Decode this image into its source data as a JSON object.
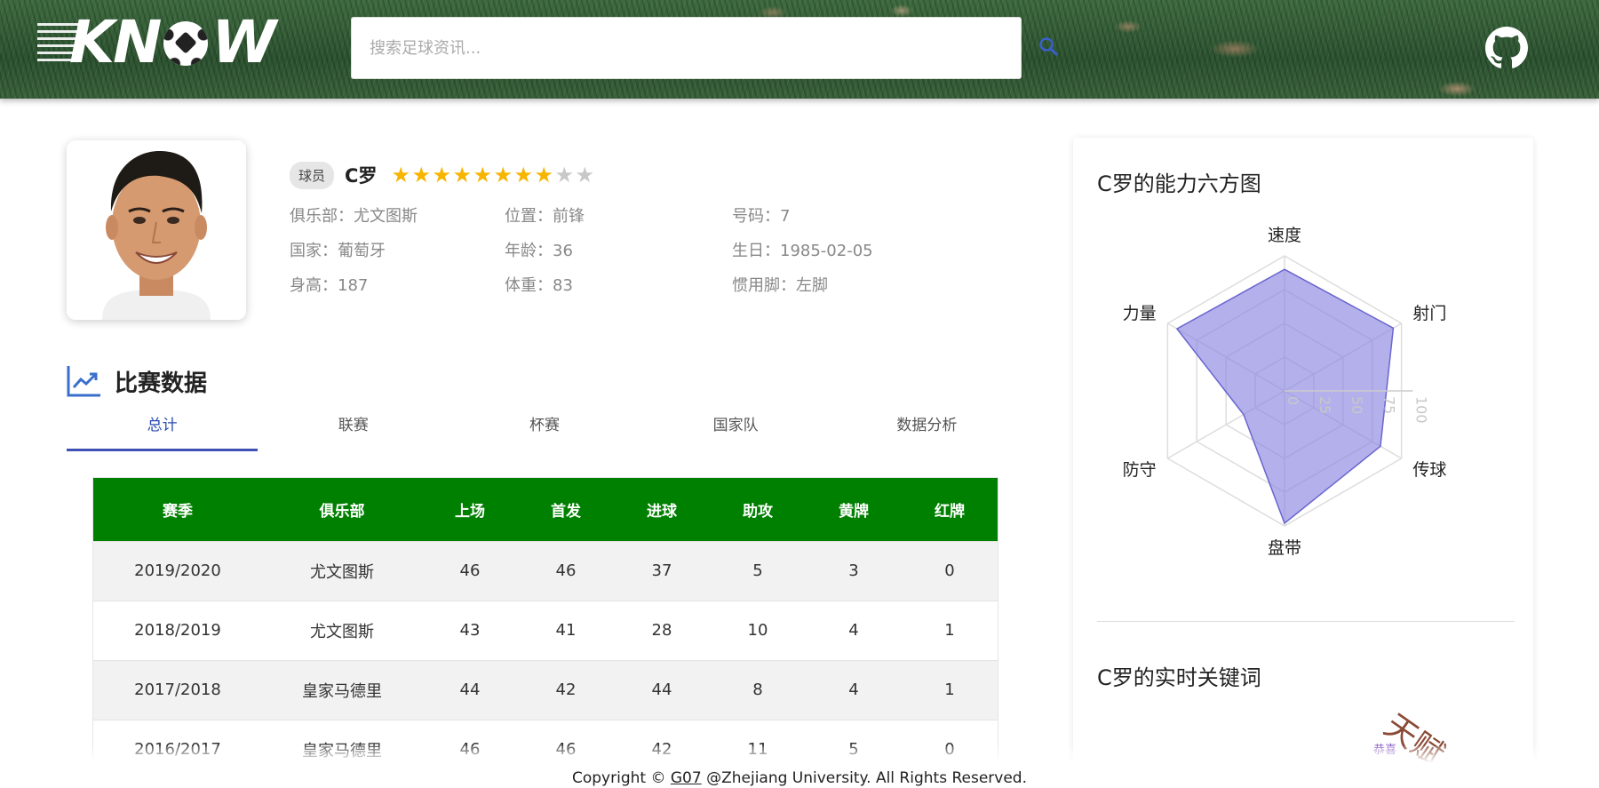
{
  "header": {
    "logo_text": "KNOWW",
    "search_placeholder": "搜索足球资讯...",
    "search_icon": "search-icon",
    "github_icon": "github-icon"
  },
  "player": {
    "tag": "球员",
    "name": "C罗",
    "rating": {
      "value": 8,
      "max": 10
    },
    "club": "俱乐部：尤文图斯",
    "position": "位置：前锋",
    "number": "号码：7",
    "country": "国家：葡萄牙",
    "age": "年龄：36",
    "birthday": "生日：1985-02-05",
    "height": "身高：187",
    "weight": "体重：83",
    "foot": "惯用脚：左脚"
  },
  "stats_section": {
    "title": "比赛数据",
    "icon": "line-chart-icon",
    "tabs": [
      "总计",
      "联赛",
      "杯赛",
      "国家队",
      "数据分析"
    ],
    "active_tab": 0,
    "columns": [
      "赛季",
      "俱乐部",
      "上场",
      "首发",
      "进球",
      "助攻",
      "黄牌",
      "红牌"
    ],
    "rows": [
      [
        "2019/2020",
        "尤文图斯",
        "46",
        "46",
        "37",
        "5",
        "3",
        "0"
      ],
      [
        "2018/2019",
        "尤文图斯",
        "43",
        "41",
        "28",
        "10",
        "4",
        "1"
      ],
      [
        "2017/2018",
        "皇家马德里",
        "44",
        "42",
        "44",
        "8",
        "4",
        "1"
      ],
      [
        "2016/2017",
        "皇家马德里",
        "46",
        "46",
        "42",
        "11",
        "5",
        "0"
      ]
    ]
  },
  "radar": {
    "title": "C罗的能力六方图",
    "axes": [
      "速度",
      "射门",
      "传球",
      "盘带",
      "防守",
      "力量"
    ],
    "values": [
      90,
      93,
      82,
      98,
      35,
      92
    ],
    "ticks": [
      "0",
      "25",
      "50",
      "75",
      "100"
    ],
    "max": 100,
    "fill": "#8a86e0",
    "stroke": "#6a66d0"
  },
  "keywords": {
    "title": "C罗的实时关键词",
    "words": [
      "天赋",
      "恭喜"
    ]
  },
  "footer": {
    "prefix": "Copyright © ",
    "link": "G07",
    "suffix": " @Zhejiang University. All Rights Reserved."
  }
}
